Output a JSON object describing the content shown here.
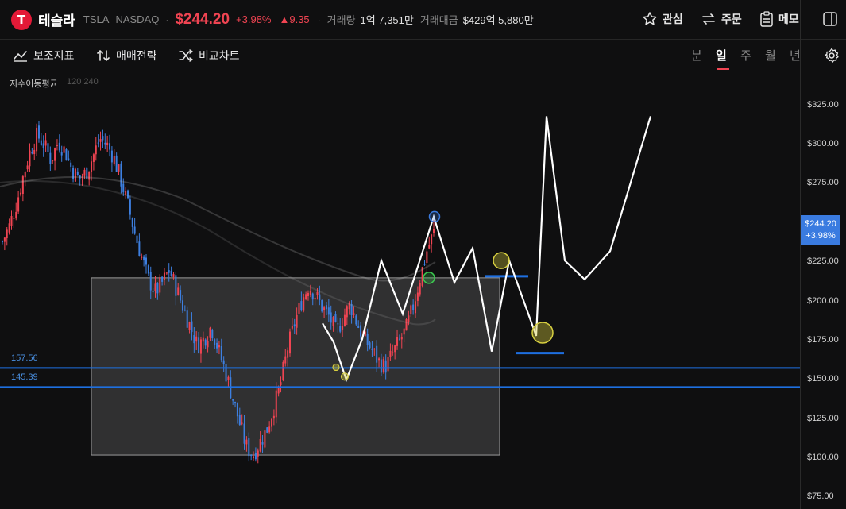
{
  "header": {
    "logo_letter": "T",
    "name": "테슬라",
    "ticker": "TSLA",
    "exchange": "NASDAQ",
    "separator": "·",
    "price": "$244.20",
    "change_pct": "+3.98%",
    "change_abs": "▲9.35",
    "volume_label": "거래량",
    "volume_value": "1억 7,351만",
    "amount_label": "거래대금",
    "amount_value": "$429억 5,880만",
    "watch_label": "관심",
    "order_label": "주문",
    "memo_label": "메모"
  },
  "toolbar": {
    "indicators_label": "보조지표",
    "strategy_label": "매매전략",
    "compare_label": "비교차트",
    "periods": [
      "분",
      "일",
      "주",
      "월",
      "년"
    ],
    "active_period": "일"
  },
  "indicator": {
    "name": "지수이동평균",
    "params": "120 240"
  },
  "colors": {
    "up": "#f04452",
    "down": "#3d7fe0",
    "accent": "#3a7be0",
    "level_line": "#1e6fe0",
    "bg": "#0f0f10"
  },
  "chart_data": {
    "type": "candlestick",
    "y_ticks": [
      "$325.00",
      "$300.00",
      "$275.00",
      "$250.00",
      "$225.00",
      "$200.00",
      "$175.00",
      "$150.00",
      "$125.00",
      "$100.00",
      "$75.00"
    ],
    "y_tick_values": [
      325,
      300,
      275,
      250,
      225,
      200,
      175,
      150,
      125,
      100,
      75
    ],
    "ylim": [
      72,
      340
    ],
    "last_price_tag": [
      "$244.20",
      "+3.98%"
    ],
    "last_price": 244.2,
    "horizontal_levels": [
      {
        "label": "157.56",
        "value": 157.56
      },
      {
        "label": "145.39",
        "value": 145.39
      }
    ],
    "price_path_closes": [
      238,
      248,
      262,
      280,
      296,
      306,
      300,
      290,
      302,
      296,
      284,
      278,
      282,
      292,
      304,
      300,
      292,
      278,
      262,
      244,
      228,
      214,
      206,
      212,
      220,
      208,
      196,
      184,
      172,
      176,
      184,
      170,
      156,
      140,
      124,
      108,
      102,
      110,
      118,
      132,
      148,
      170,
      186,
      200,
      210,
      204,
      196,
      190,
      180,
      190,
      198,
      186,
      176,
      170,
      162,
      158,
      166,
      174,
      182,
      196,
      214,
      232,
      244
    ],
    "box_range": [
      102,
      215
    ],
    "projection_path": [
      186,
      174,
      150,
      176,
      226,
      192,
      254,
      212,
      234,
      168,
      226,
      178,
      318,
      226,
      214,
      232,
      318,
      264
    ],
    "marker_circles": [
      254,
      215,
      226,
      180,
      158,
      152
    ]
  }
}
